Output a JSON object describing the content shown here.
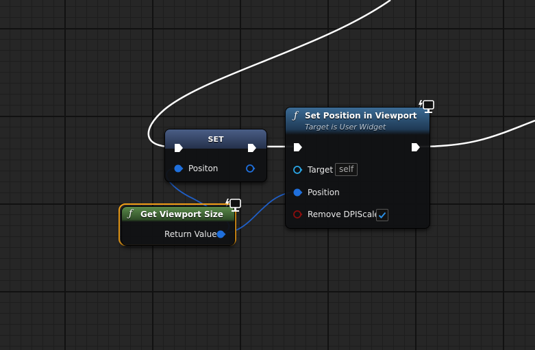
{
  "nodes": {
    "set_node": {
      "title": "SET",
      "var_label": "Positon"
    },
    "set_position": {
      "title": "Set Position in Viewport",
      "subtitle": "Target is User Widget",
      "target_label": "Target",
      "target_value": "self",
      "position_label": "Position",
      "remove_dpi_label": "Remove DPIScale",
      "remove_dpi_checked": true
    },
    "get_viewport_size": {
      "title": "Get Viewport Size",
      "return_label": "Return Value"
    }
  },
  "icons": {
    "function": "function-icon",
    "client_only": "client-only-monitor-icon"
  },
  "colors": {
    "background": "#262626",
    "exec_wire": "#ffffff",
    "vector_pin": "#1f6fdc",
    "object_pin": "#2aa6e6",
    "bool_pin": "#8b0d0d",
    "pure_header": "#4c7a3f",
    "function_header": "#2f5a80",
    "variable_header": "#3b4f74",
    "selection": "#f3a118"
  }
}
